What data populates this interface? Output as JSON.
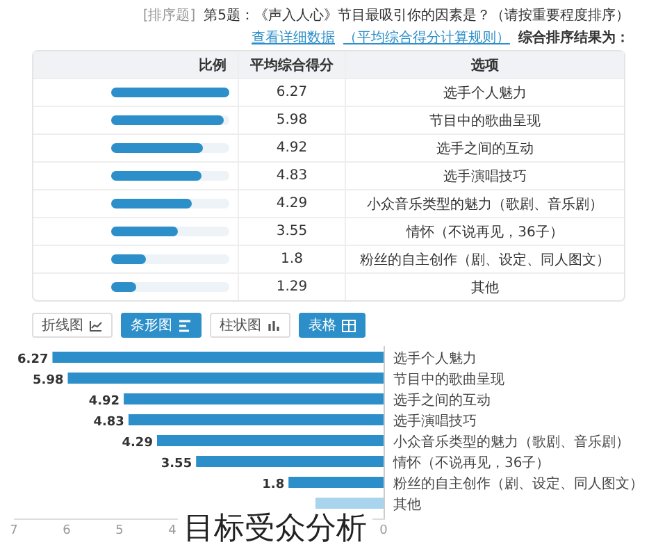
{
  "question": {
    "title": "第5题：《声入人心》节目最吸引你的因素是？（请按重要程度排序）",
    "tag": "[排序题]"
  },
  "summary": {
    "label": "综合排序结果为：",
    "rule_link": "（平均综合得分计算规则）",
    "detail_link": "查看详细数据"
  },
  "table": {
    "columns": [
      "比例",
      "平均综合得分",
      "选项"
    ],
    "rows": [
      {
        "option": "选手个人魅力",
        "score": "6.27",
        "level": 1
      },
      {
        "option": "节目中的歌曲呈现",
        "score": "5.98",
        "level": 0.95
      },
      {
        "option": "选手之间的互动",
        "score": "4.92",
        "level": 0.78
      },
      {
        "option": "选手演唱技巧",
        "score": "4.83",
        "level": 0.77
      },
      {
        "option": "小众音乐类型的魅力（歌剧、音乐剧）",
        "score": "4.29",
        "level": 0.68
      },
      {
        "option": "情怀（不说再见，36子）",
        "score": "3.55",
        "level": 0.57
      },
      {
        "option": "粉丝的自主创作（剧、设定、同人图文）",
        "score": "1.8",
        "level": 0.29
      },
      {
        "option": "其他",
        "score": "1.29",
        "level": 0.21
      }
    ]
  },
  "view_buttons": [
    {
      "label": "折线图",
      "kind": "line",
      "selected": false
    },
    {
      "label": "条形图",
      "kind": "hbar",
      "selected": true
    },
    {
      "label": "柱状图",
      "kind": "column",
      "selected": false
    },
    {
      "label": "表格",
      "kind": "table",
      "selected": true
    }
  ],
  "chart": {
    "chart_data": {
      "type": "bar",
      "orientation": "horizontal",
      "categories": [
        "选手个人魅力",
        "节目中的歌曲呈现",
        "选手之间的互动",
        "选手演唱技巧",
        "小众音乐类型的魅力（歌剧、音乐剧）",
        "情怀（不说再见，36子）",
        "粉丝的自主创作（剧、设定、同人图文）",
        "其他"
      ],
      "values": [
        6.27,
        5.98,
        4.92,
        4.83,
        4.29,
        3.55,
        1.8,
        1.29
      ],
      "value_labels": [
        "6.27",
        "5.98",
        "4.92",
        "4.83",
        "4.29",
        "3.55",
        "1.8",
        null
      ],
      "xlim": [
        7,
        0
      ],
      "xticks": [
        7,
        6,
        5,
        4,
        0
      ]
    }
  },
  "caption": "目标受众分析"
}
